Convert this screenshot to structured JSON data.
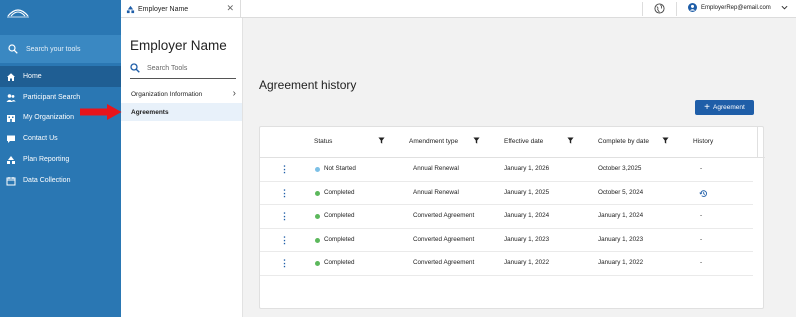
{
  "sidebar": {
    "logo_text": "",
    "search_placeholder": "Search your tools",
    "items": [
      {
        "label": "Home",
        "icon": "home-icon",
        "active": true
      },
      {
        "label": "Participant Search",
        "icon": "people-icon",
        "active": false
      },
      {
        "label": "My Organization",
        "icon": "organization-icon",
        "active": false
      },
      {
        "label": "Contact Us",
        "icon": "chat-icon",
        "active": false
      },
      {
        "label": "Plan Reporting",
        "icon": "reporting-icon",
        "active": false
      },
      {
        "label": "Data Collection",
        "icon": "calendar-icon",
        "active": false
      }
    ]
  },
  "topbar": {
    "tab_label": "Employer Name",
    "user_email": "EmployerRep@email.com"
  },
  "employer_panel": {
    "title": "Employer Name",
    "search_placeholder": "Search Tools",
    "menu": [
      {
        "label": "Organization Information",
        "has_chevron": true
      },
      {
        "label": "Agreements",
        "active": true
      }
    ]
  },
  "main": {
    "title": "Agreement history",
    "add_button_label": "Agreement",
    "columns": [
      "Status",
      "Amendment type",
      "Effective date",
      "Complete by date",
      "History"
    ],
    "rows": [
      {
        "status": "Not Started",
        "status_color": "#7cc0e6",
        "amendment": "Annual Renewal",
        "effective": "January 1, 2026",
        "complete_by": "October 3,2025",
        "history": "-"
      },
      {
        "status": "Completed",
        "status_color": "#5cb85c",
        "amendment": "Annual Renewal",
        "effective": "January 1, 2025",
        "complete_by": "October 5, 2024",
        "history": "history-icon"
      },
      {
        "status": "Completed",
        "status_color": "#5cb85c",
        "amendment": "Converted Agreement",
        "effective": "January 1, 2024",
        "complete_by": "January 1, 2024",
        "history": "-"
      },
      {
        "status": "Completed",
        "status_color": "#5cb85c",
        "amendment": "Converted Agreement",
        "effective": "January 1, 2023",
        "complete_by": "January 1, 2023",
        "history": "-"
      },
      {
        "status": "Completed",
        "status_color": "#5cb85c",
        "amendment": "Converted Agreement",
        "effective": "January 1, 2022",
        "complete_by": "January 1, 2022",
        "history": "-"
      }
    ]
  },
  "colors": {
    "sidebar": "#2a77b3",
    "accent": "#1f5ea8",
    "highlight_arrow": "#e8141b"
  }
}
